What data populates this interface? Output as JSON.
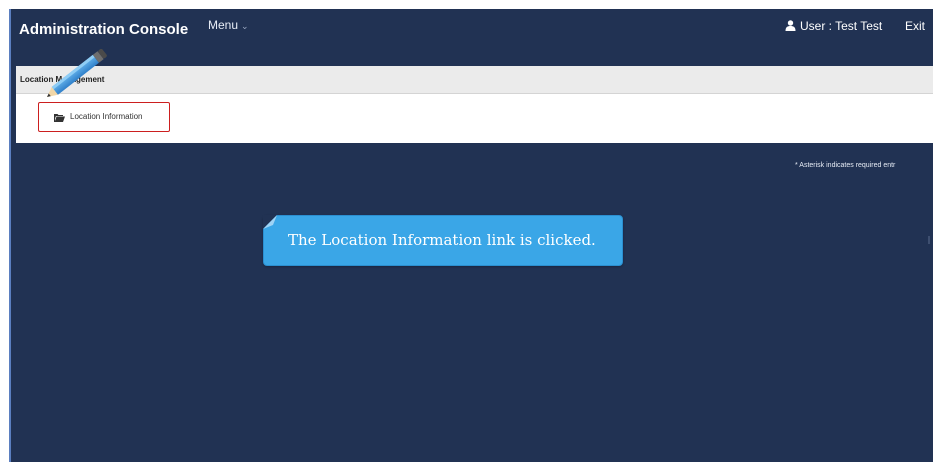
{
  "navbar": {
    "brand": "Administration Console",
    "menu_label": "Menu",
    "menu_caret": "⌄",
    "user_label": "User : Test Test",
    "exit_label": "Exit"
  },
  "panel": {
    "title": "Location Management",
    "link_label": "Location Information"
  },
  "note": "* Asterisk indicates required entr",
  "callout": {
    "text": "The Location Information link is clicked."
  },
  "icons": {
    "user": "user-icon",
    "folder": "folder-open-icon",
    "pencil": "pencil-icon",
    "menu_caret": "chevron-down-icon"
  },
  "colors": {
    "background": "#213253",
    "callout": "#3aa6e7",
    "highlight": "#cc1f1f",
    "panel_header": "#ebebeb"
  }
}
